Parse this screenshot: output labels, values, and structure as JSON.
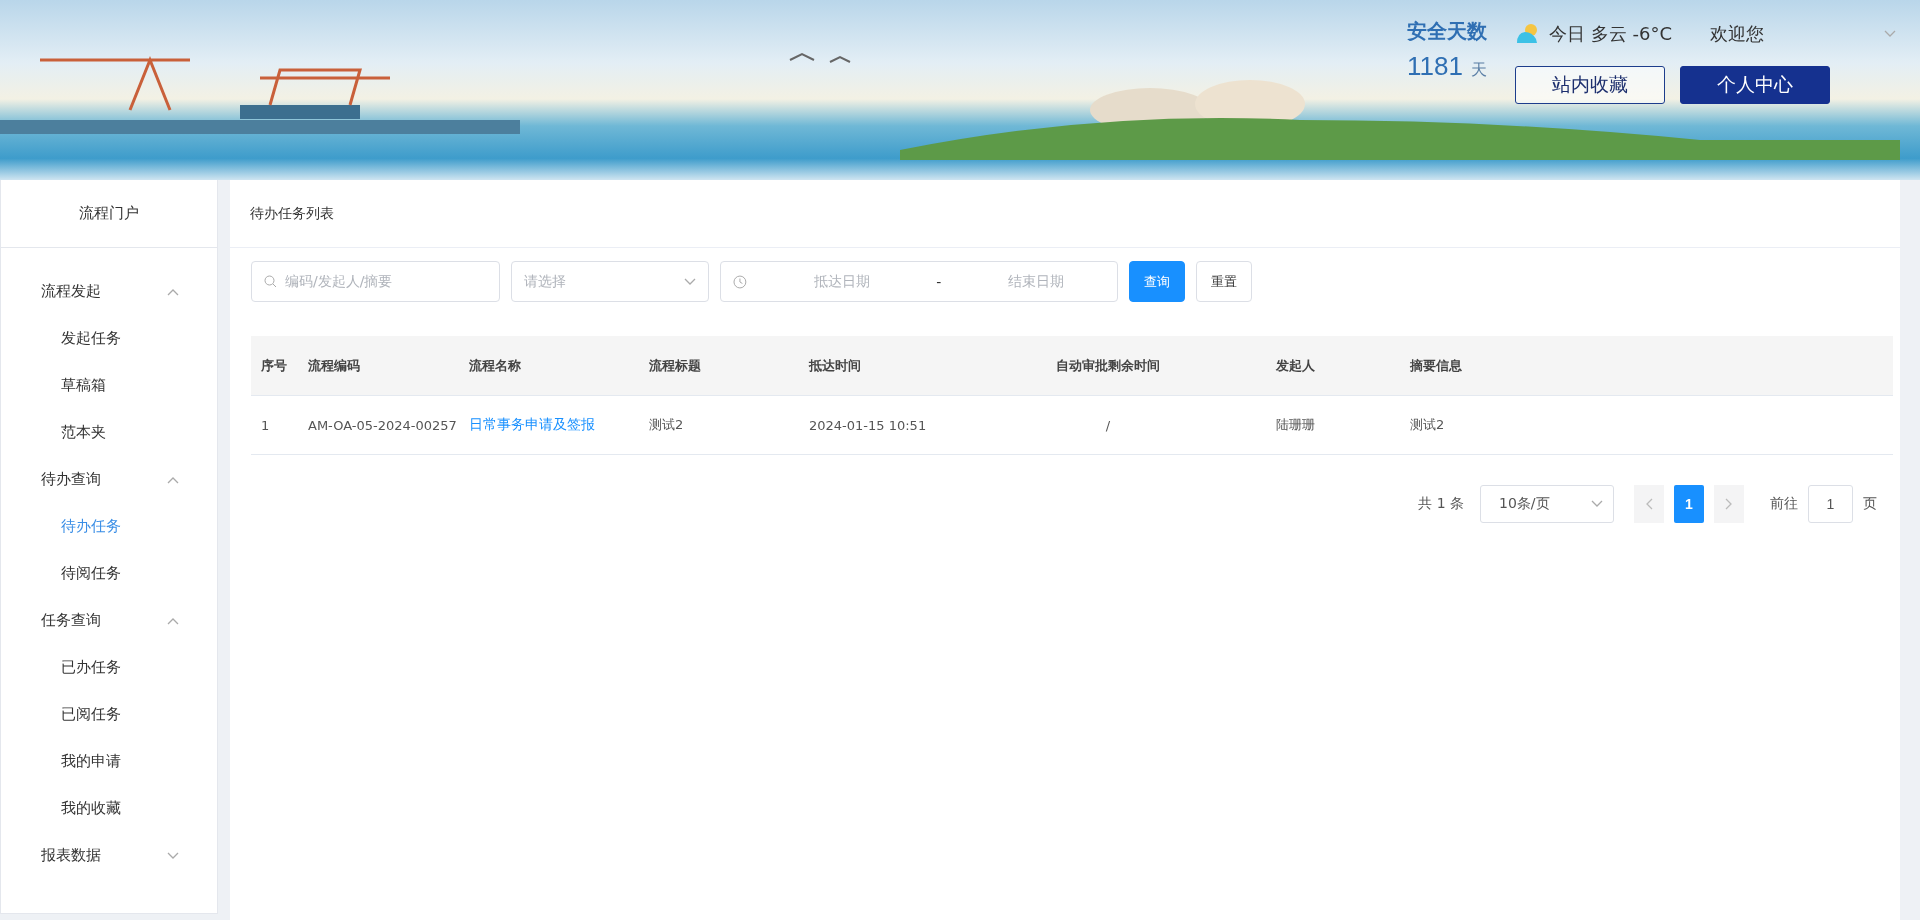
{
  "header": {
    "safety_label": "安全天数",
    "safety_days": "1181",
    "safety_unit": "天",
    "weather": "今日 多云 -6°C",
    "welcome": "欢迎您",
    "buttons": [
      {
        "label": "站内收藏",
        "kind": "outline"
      },
      {
        "label": "个人中心",
        "kind": "primary"
      }
    ]
  },
  "sidebar": {
    "title": "流程门户",
    "groups": [
      {
        "label": "流程发起",
        "expanded": true,
        "children": [
          {
            "label": "发起任务",
            "selected": false
          },
          {
            "label": "草稿箱",
            "selected": false
          },
          {
            "label": "范本夹",
            "selected": false
          }
        ]
      },
      {
        "label": "待办查询",
        "expanded": true,
        "children": [
          {
            "label": "待办任务",
            "selected": true
          },
          {
            "label": "待阅任务",
            "selected": false
          }
        ]
      },
      {
        "label": "任务查询",
        "expanded": true,
        "children": [
          {
            "label": "已办任务",
            "selected": false
          },
          {
            "label": "已阅任务",
            "selected": false
          },
          {
            "label": "我的申请",
            "selected": false
          },
          {
            "label": "我的收藏",
            "selected": false
          }
        ]
      },
      {
        "label": "报表数据",
        "expanded": false
      }
    ]
  },
  "page": {
    "title": "待办任务列表"
  },
  "filters": {
    "search": {
      "placeholder": "编码/发起人/摘要"
    },
    "select": {
      "placeholder": "请选择"
    },
    "start_date": {
      "placeholder": "抵达日期"
    },
    "separator": "-",
    "end_date": {
      "placeholder": "结束日期"
    },
    "buttons": [
      {
        "label": "查询",
        "kind": "primary"
      },
      {
        "label": "重置",
        "kind": "plain"
      }
    ]
  },
  "table": {
    "columns": [
      "序号",
      "流程编码",
      "流程名称",
      "流程标题",
      "抵达时间",
      "自动审批剩余时间",
      "发起人",
      "摘要信息"
    ],
    "rows": [
      {
        "cells": [
          "1",
          "AM-OA-05-2024-00257",
          "日常事务申请及签报",
          "测试2",
          "2024-01-15 10:51",
          "/",
          "陆珊珊",
          "测试2"
        ]
      }
    ]
  },
  "pagination": {
    "total": "共 1 条",
    "page_size": "10条/页",
    "pages": [
      {
        "label": "1",
        "selected": true
      }
    ],
    "goto_label": "前往",
    "goto_value": "1",
    "goto_unit": "页"
  }
}
